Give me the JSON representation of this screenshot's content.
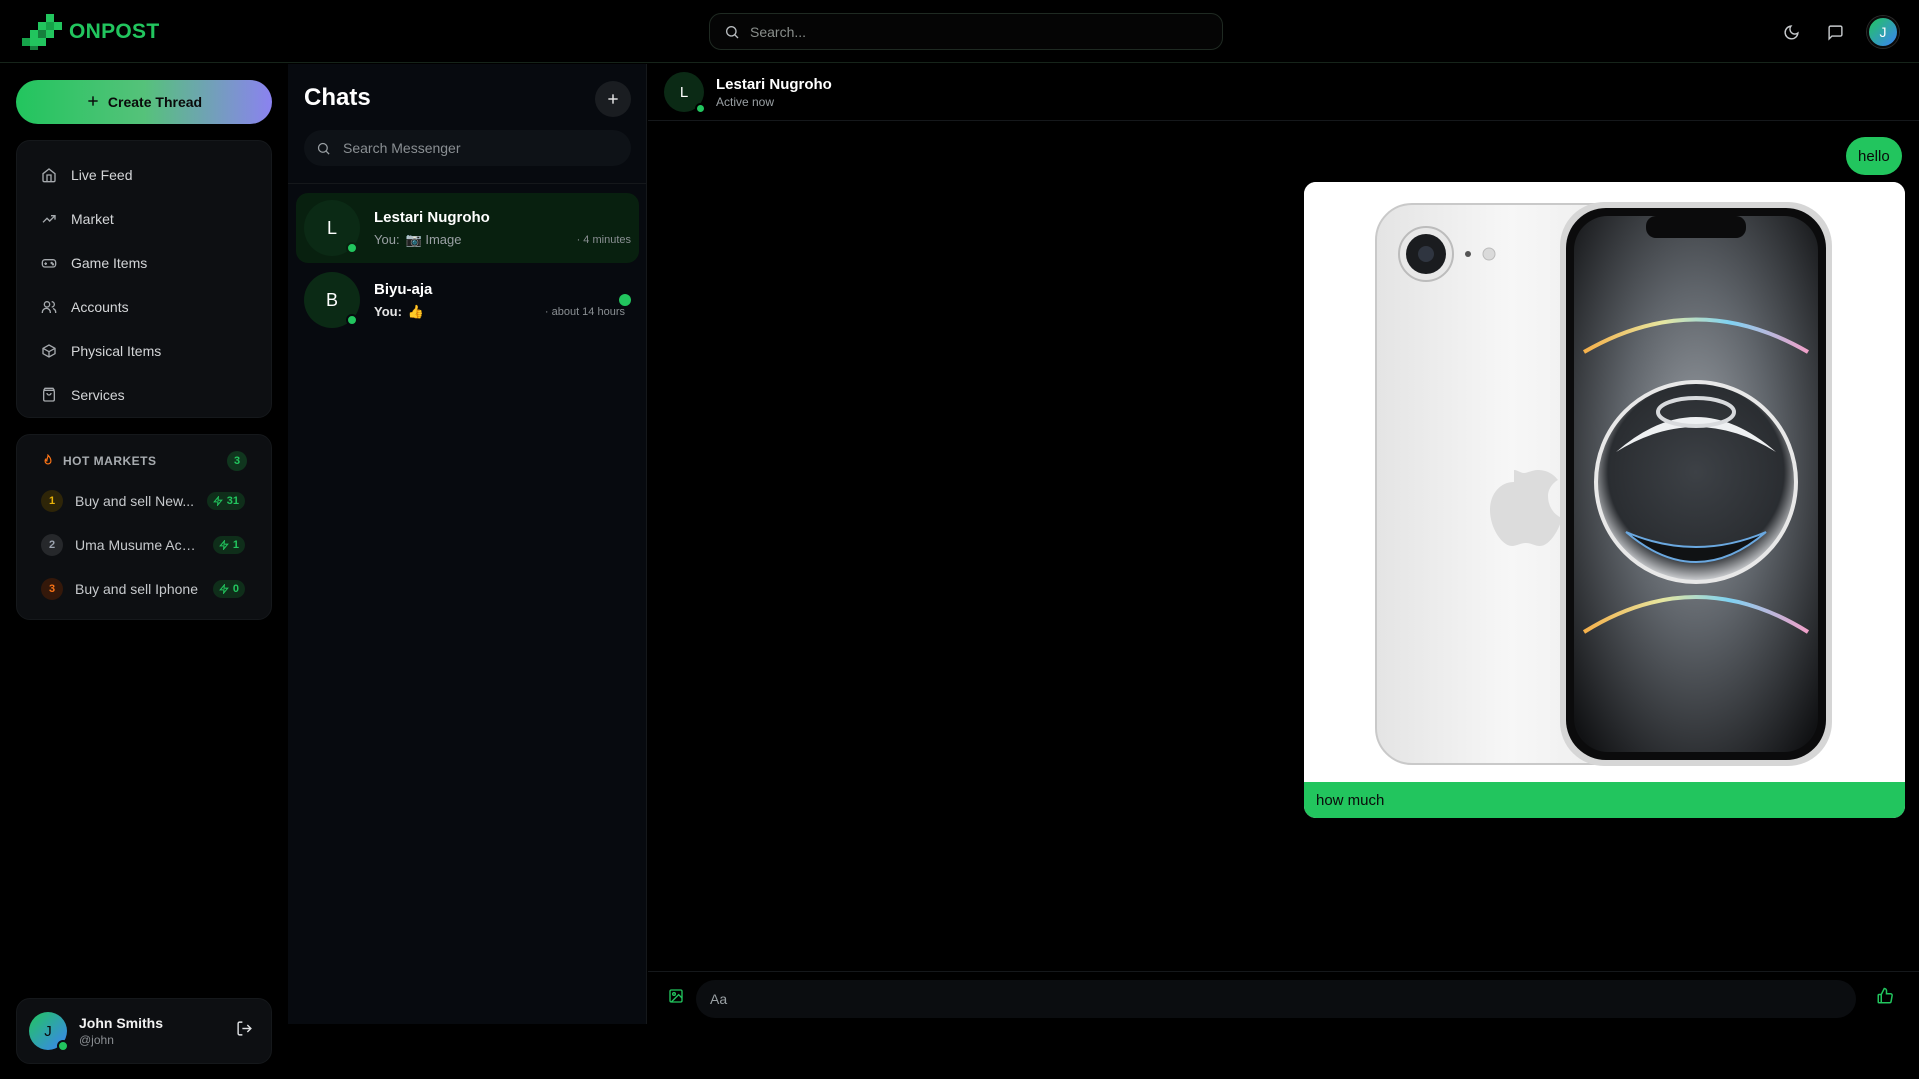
{
  "app": {
    "name": "ONPOST"
  },
  "topbar": {
    "search_placeholder": "Search...",
    "icons": [
      "moon-icon",
      "message-square-icon"
    ],
    "avatar_initial": "J"
  },
  "sidebar": {
    "create_label": "Create Thread",
    "nav": [
      {
        "label": "Live Feed",
        "icon": "home-icon"
      },
      {
        "label": "Market",
        "icon": "trending-up-icon"
      },
      {
        "label": "Game Items",
        "icon": "gamepad-icon"
      },
      {
        "label": "Accounts",
        "icon": "users-icon"
      },
      {
        "label": "Physical Items",
        "icon": "box-icon"
      },
      {
        "label": "Services",
        "icon": "shopping-bag-icon"
      }
    ],
    "hot": {
      "title": "HOT MARKETS",
      "count": "3",
      "items": [
        {
          "rank": "1",
          "label": "Buy and sell New...",
          "count": "31",
          "rank_color": "#eab308"
        },
        {
          "rank": "2",
          "label": "Uma Musume Acc...",
          "count": "1",
          "rank_color": "#9ca3af"
        },
        {
          "rank": "3",
          "label": "Buy and sell Iphone",
          "count": "0",
          "rank_color": "#f97316"
        }
      ]
    },
    "user": {
      "initial": "J",
      "name": "John Smiths",
      "handle": "@john"
    }
  },
  "chats": {
    "title": "Chats",
    "search_placeholder": "Search Messenger",
    "conversations": [
      {
        "initial": "L",
        "name": "Lestari Nugroho",
        "prefix": "You:",
        "preview": "📷 Image",
        "time": "· 4 minutes",
        "active": true
      },
      {
        "initial": "B",
        "name": "Biyu-aja",
        "prefix": "You:",
        "preview": "👍",
        "time": "· about 14 hours",
        "unread": true
      }
    ]
  },
  "conversation": {
    "initial": "L",
    "name": "Lestari Nugroho",
    "status": "Active now",
    "messages": [
      {
        "text": "hello"
      },
      {
        "caption": "how much"
      }
    ],
    "composer_placeholder": "Aa"
  },
  "colors": {
    "accent": "#22c55e",
    "background": "#000000"
  }
}
